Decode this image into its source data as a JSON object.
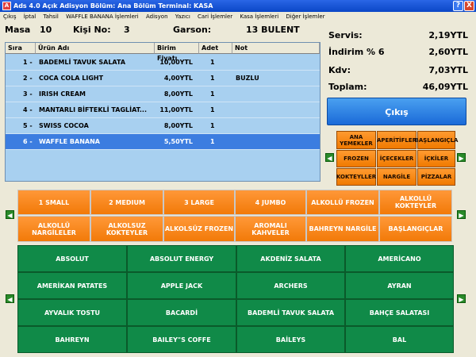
{
  "window": {
    "title": "Ads 4.0 Açık Adisyon Bölüm: Ana Bölüm Terminal: KASA",
    "help_label": "?",
    "close_label": "X"
  },
  "menu": [
    "Çıkış",
    "İptal",
    "Tahsil",
    "WAFFLE BANANA İşlemleri",
    "Adisyon",
    "Yazıcı",
    "Cari İşlemler",
    "Kasa İşlemleri",
    "Diğer İşlemler"
  ],
  "info": {
    "masa_label": "Masa",
    "masa_value": "10",
    "kisi_label": "Kişi No:",
    "kisi_value": "3",
    "garson_label": "Garson:",
    "garson_value": "13 BULENT"
  },
  "table": {
    "columns": [
      "Sıra",
      "Ürün Adı",
      "Birim Fiyatı",
      "Adet",
      "Not"
    ],
    "rows": [
      {
        "sira": "1 -",
        "urun": "BADEMLİ TAVUK SALATA",
        "fiyat": "10,00YTL",
        "adet": "1",
        "not": ""
      },
      {
        "sira": "2 -",
        "urun": "COCA COLA LIGHT",
        "fiyat": "4,00YTL",
        "adet": "1",
        "not": "BUZLU"
      },
      {
        "sira": "3 -",
        "urun": "IRISH CREAM",
        "fiyat": "8,00YTL",
        "adet": "1",
        "not": ""
      },
      {
        "sira": "4 -",
        "urun": "MANTARLI BİFTEKLİ TAGLİAT...",
        "fiyat": "11,00YTL",
        "adet": "1",
        "not": ""
      },
      {
        "sira": "5 -",
        "urun": "SWISS COCOA",
        "fiyat": "8,00YTL",
        "adet": "1",
        "not": ""
      },
      {
        "sira": "6 -",
        "urun": "WAFFLE BANANA",
        "fiyat": "5,50YTL",
        "adet": "1",
        "not": ""
      }
    ]
  },
  "totals": {
    "servis_label": "Servis:",
    "servis_value": "2,19YTL",
    "indirim_label": "İndirim % 6",
    "indirim_value": "2,60YTL",
    "kdv_label": "Kdv:",
    "kdv_value": "7,03YTL",
    "toplam_label": "Toplam:",
    "toplam_value": "46,09YTL"
  },
  "exit_label": "Çıkış",
  "categories": [
    "ANA YEMEKLER",
    "APERİTİFLER",
    "BAŞLANGIÇLA",
    "FROZEN",
    "İÇECEKLER",
    "İÇKİLER",
    "KOKTEYLLER",
    "NARGİLE",
    "PİZZALAR"
  ],
  "groups": [
    "1 SMALL",
    "2 MEDIUM",
    "3 LARGE",
    "4 JUMBO",
    "ALKOLLÜ FROZEN",
    "ALKOLLÜ KOKTEYLER",
    "ALKOLLÜ NARGİLELER",
    "ALKOLSUZ KOKTEYLER",
    "ALKOLSÜZ FROZEN",
    "AROMALI KAHVELER",
    "BAHREYN NARGİLE",
    "BAŞLANGIÇLAR"
  ],
  "products": [
    "ABSOLUT",
    "ABSOLUT ENERGY",
    "AKDENİZ SALATA",
    "AMERİCANO",
    "AMERİKAN PATATES",
    "APPLE JACK",
    "ARCHERS",
    "AYRAN",
    "AYVALIK TOSTU",
    "BACARDİ",
    "BADEMLİ TAVUK SALATA",
    "BAHÇE SALATASI",
    "BAHREYN",
    "BAILEY\"S COFFE",
    "BAİLEYS",
    "BAL"
  ],
  "arrows": {
    "left": "◀",
    "right": "▶"
  },
  "colors": {
    "title_blue": "#0a46c6",
    "orange": "#f07a00",
    "green": "#108a48",
    "selected_row": "#3c7de0",
    "table_bg": "#a8d0f0"
  }
}
